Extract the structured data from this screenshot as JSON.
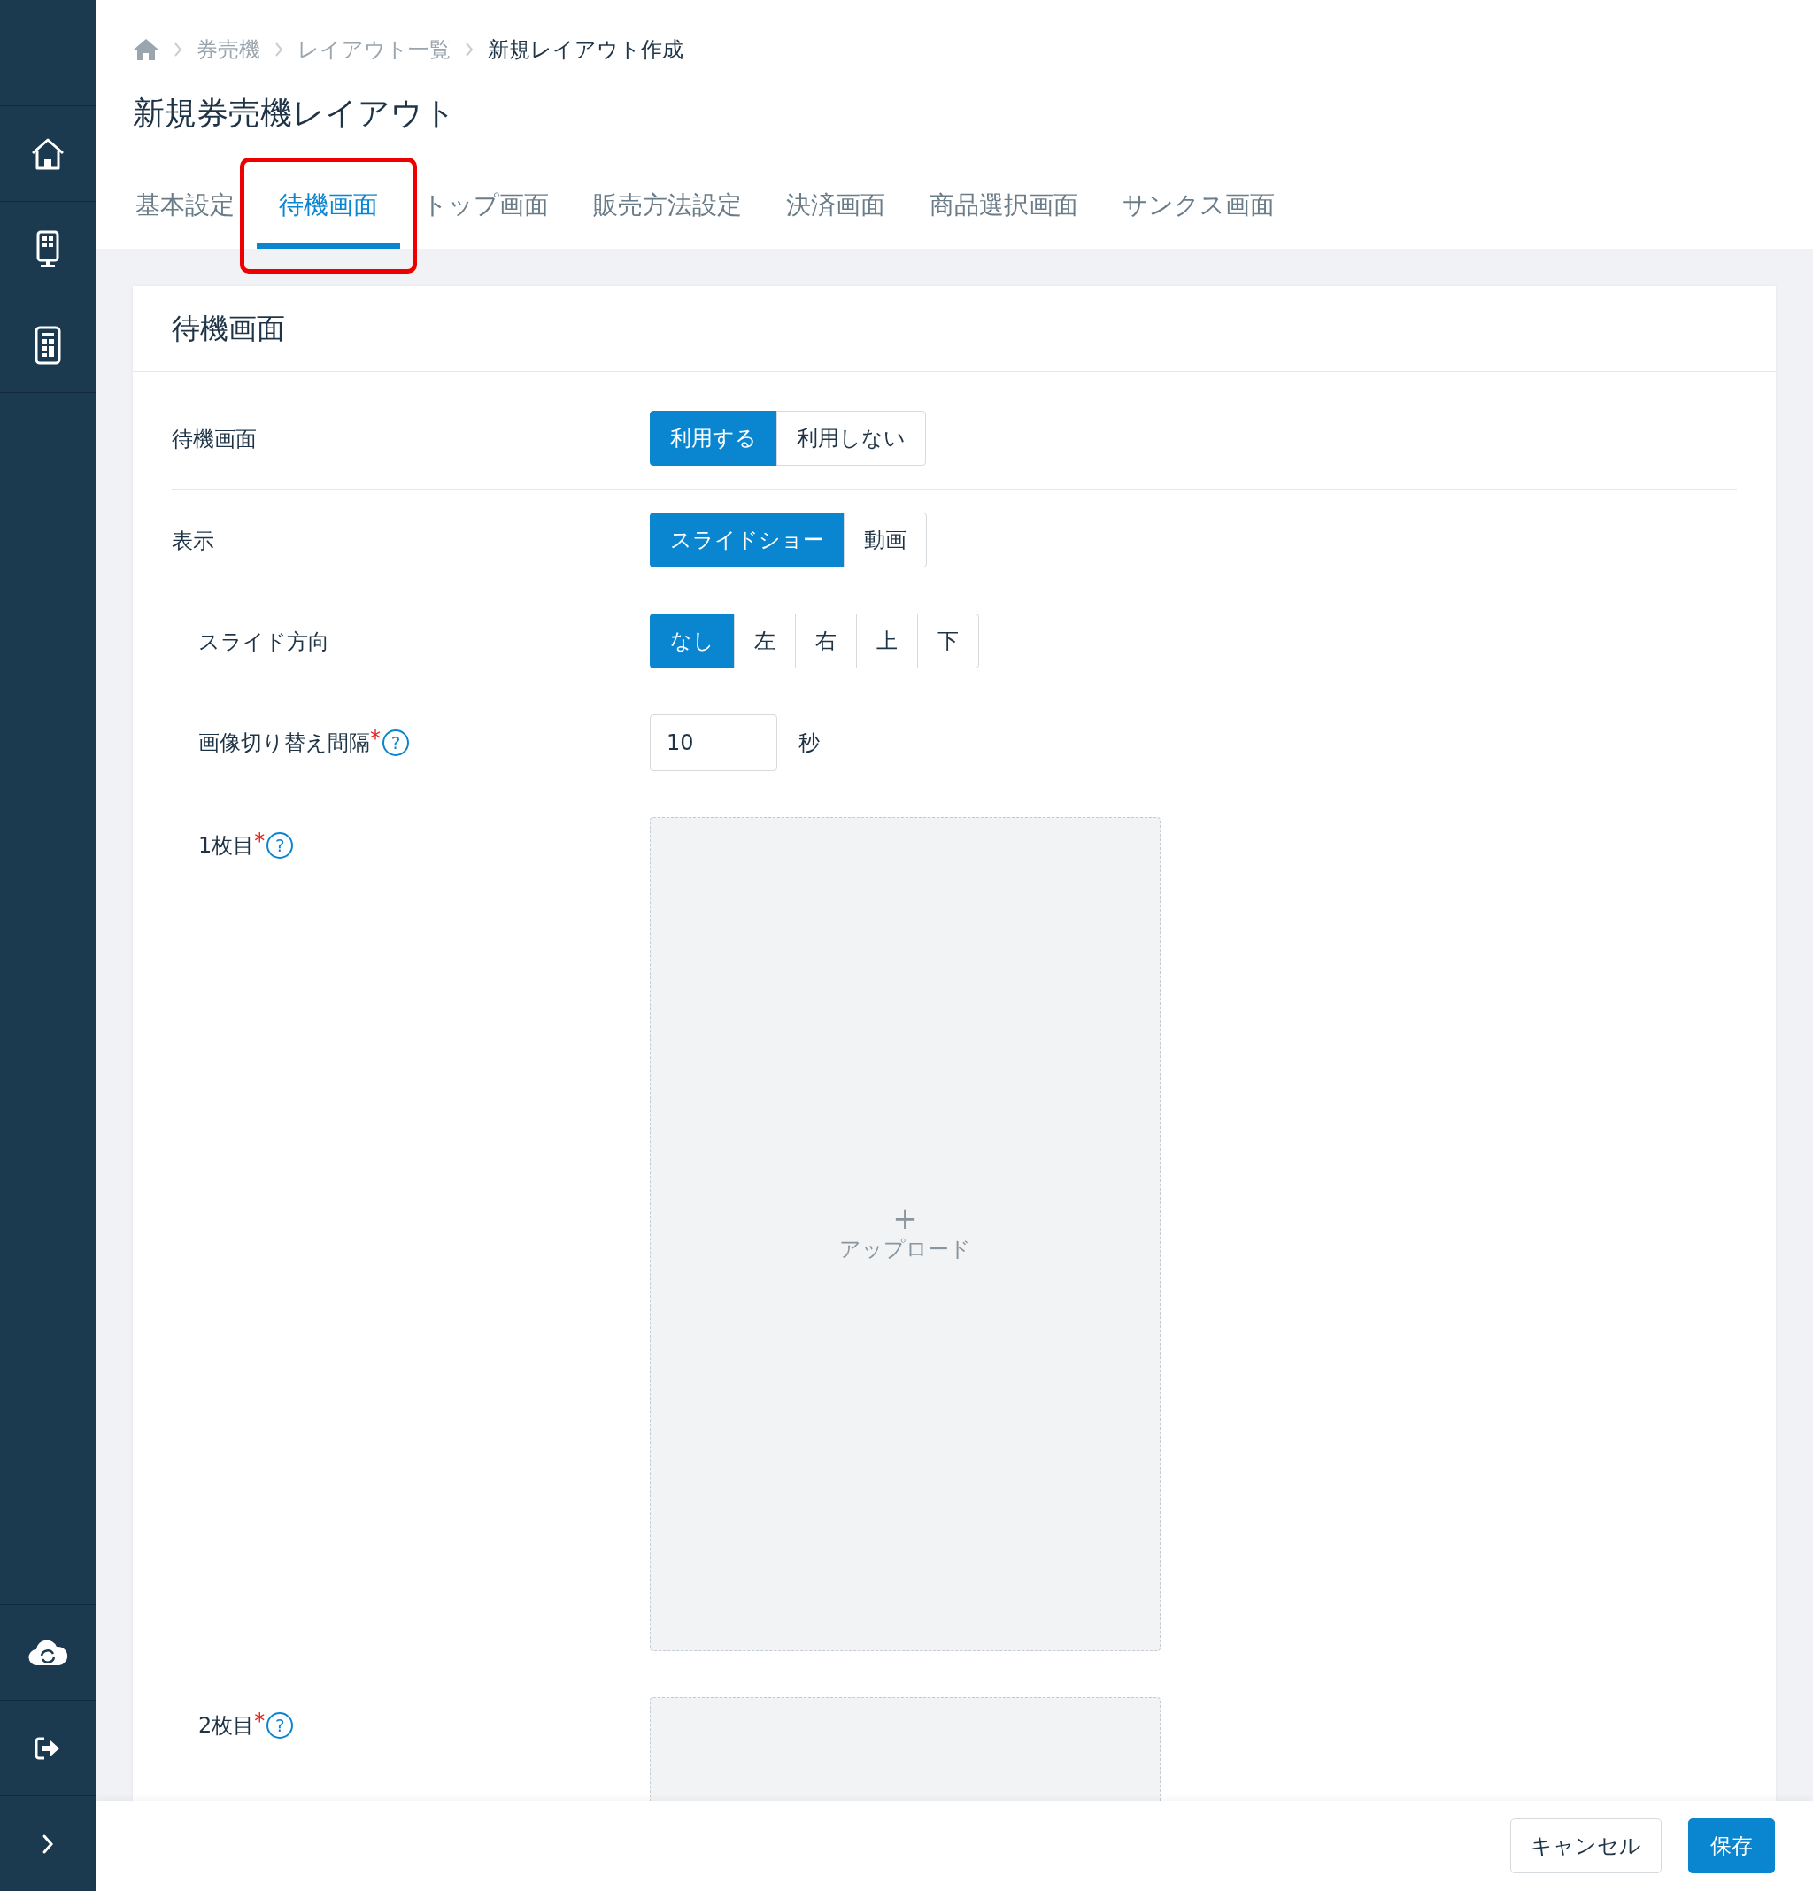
{
  "breadcrumb": [
    {
      "label": "券売機",
      "current": false
    },
    {
      "label": "レイアウト一覧",
      "current": false
    },
    {
      "label": "新規レイアウト作成",
      "current": true
    }
  ],
  "page_title": "新規券売機レイアウト",
  "tabs": [
    {
      "label": "基本設定",
      "selected": false,
      "highlighted": false
    },
    {
      "label": "待機画面",
      "selected": true,
      "highlighted": true
    },
    {
      "label": "トップ画面",
      "selected": false,
      "highlighted": false
    },
    {
      "label": "販売方法設定",
      "selected": false,
      "highlighted": false
    },
    {
      "label": "決済画面",
      "selected": false,
      "highlighted": false
    },
    {
      "label": "商品選択画面",
      "selected": false,
      "highlighted": false
    },
    {
      "label": "サンクス画面",
      "selected": false,
      "highlighted": false
    }
  ],
  "card": {
    "title": "待機画面",
    "rows": [
      {
        "kind": "segmented",
        "label": "待機画面",
        "options": [
          {
            "label": "利用する",
            "selected": true
          },
          {
            "label": "利用しない",
            "selected": false
          }
        ]
      },
      {
        "kind": "segmented",
        "label": "表示",
        "options": [
          {
            "label": "スライドショー",
            "selected": true
          },
          {
            "label": "動画",
            "selected": false
          }
        ],
        "children": [
          {
            "kind": "segmented",
            "label": "スライド方向",
            "options": [
              {
                "label": "なし",
                "selected": true
              },
              {
                "label": "左",
                "selected": false
              },
              {
                "label": "右",
                "selected": false
              },
              {
                "label": "上",
                "selected": false
              },
              {
                "label": "下",
                "selected": false
              }
            ]
          },
          {
            "kind": "number",
            "label": "画像切り替え間隔",
            "required": "*",
            "help": "?",
            "value": "10",
            "unit": "秒"
          },
          {
            "kind": "upload",
            "label": "1枚目",
            "required": "*",
            "help": "?",
            "plus": "+",
            "action": "アップロード"
          },
          {
            "kind": "upload",
            "label": "2枚目",
            "required": "*",
            "help": "?"
          }
        ]
      }
    ]
  },
  "footer": {
    "buttons": [
      {
        "label": "キャンセル",
        "kind": "secondary"
      },
      {
        "label": "保存",
        "kind": "primary"
      }
    ]
  }
}
